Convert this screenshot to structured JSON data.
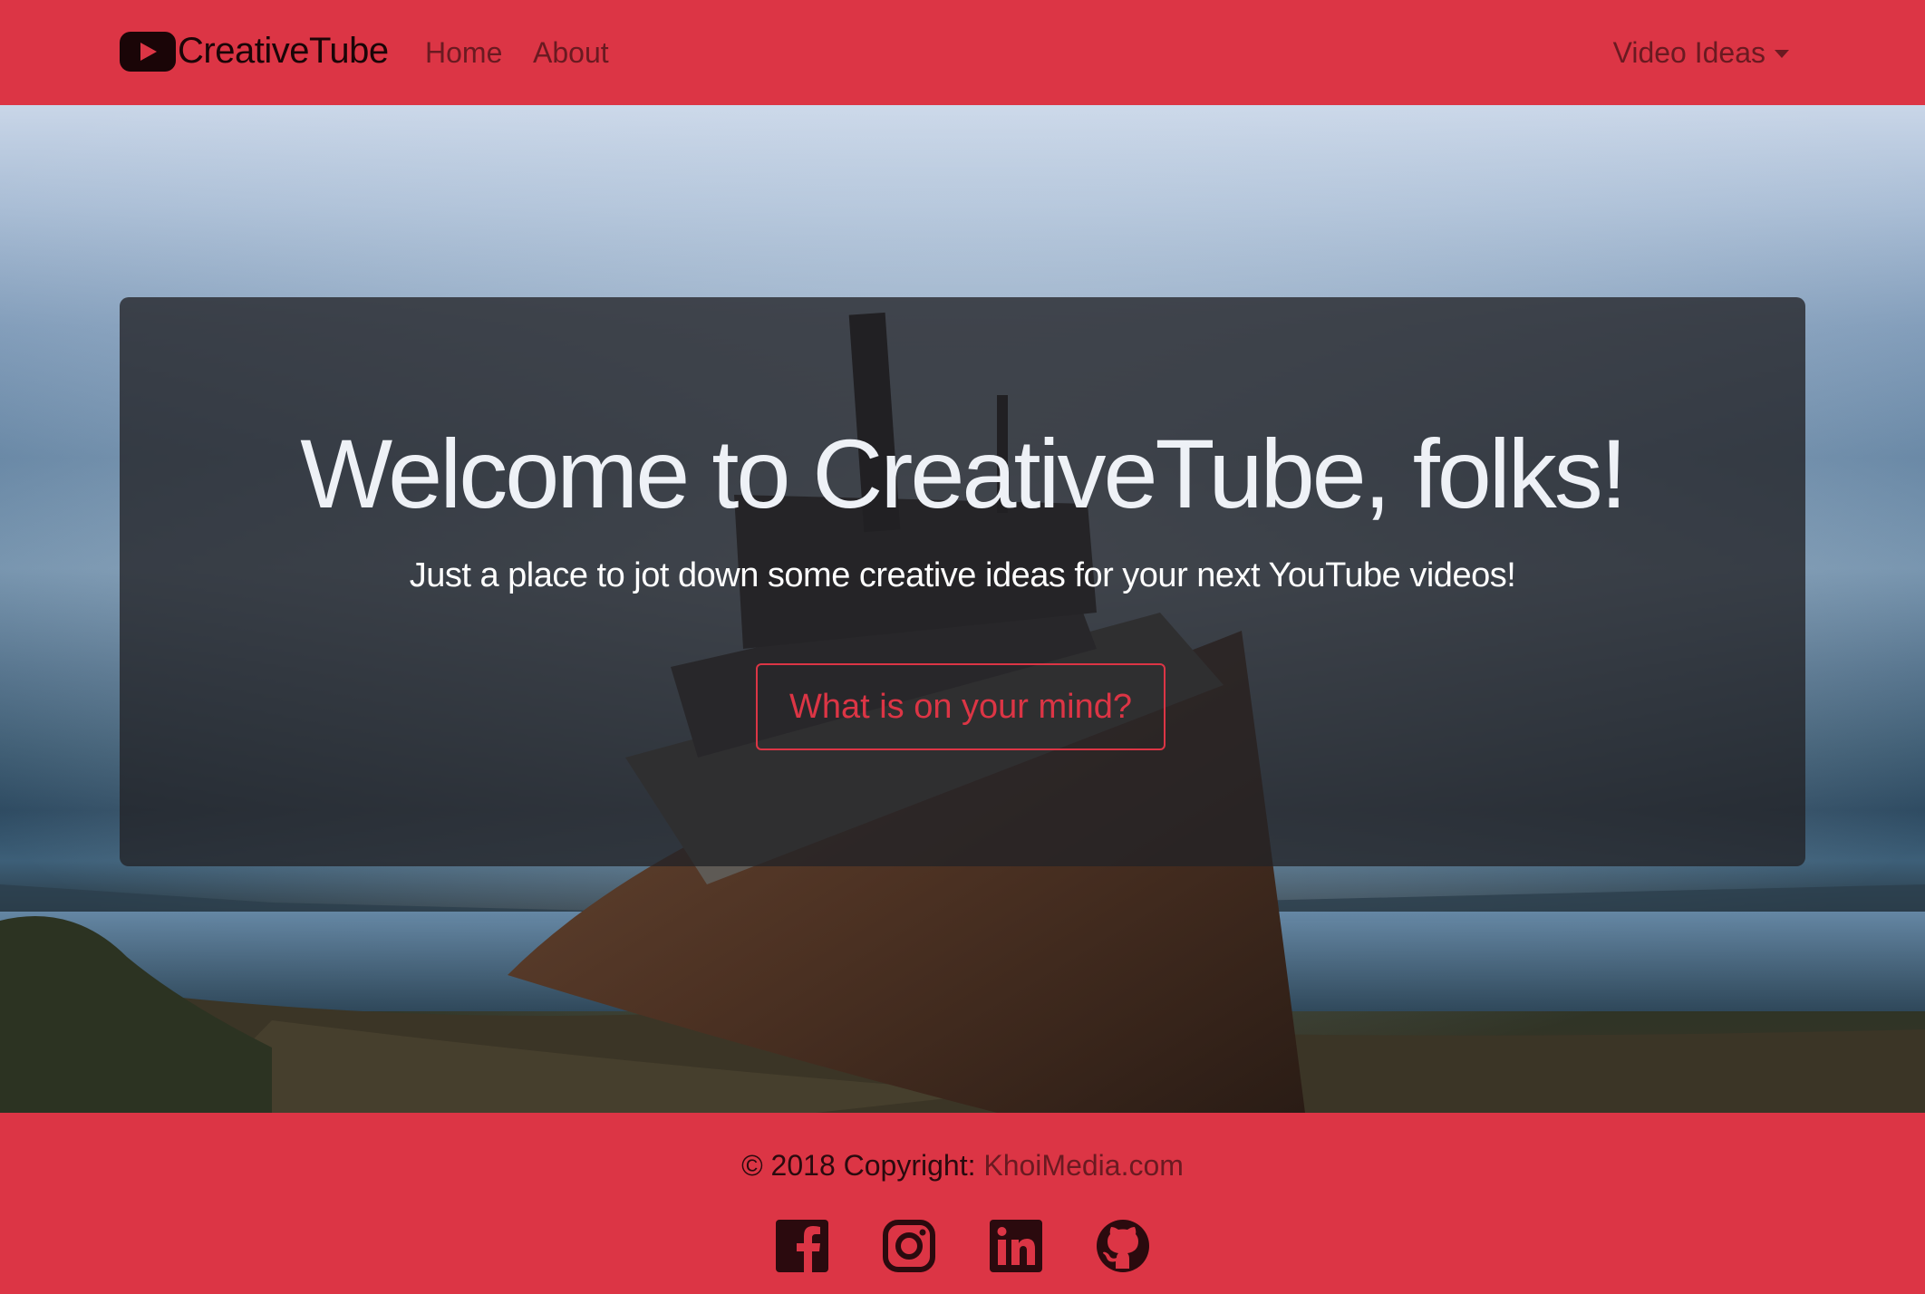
{
  "navbar": {
    "brand": "CreativeTube",
    "links": [
      "Home",
      "About"
    ],
    "dropdown_label": "Video Ideas"
  },
  "hero": {
    "title": "Welcome to CreativeTube, folks!",
    "subtitle": "Just a place to jot down some creative ideas for your next YouTube videos!",
    "button_label": "What is on your mind?"
  },
  "footer": {
    "copyright_prefix": "© 2018 Copyright: ",
    "copyright_link": "KhoiMedia.com",
    "social_icons": [
      "facebook-icon",
      "instagram-icon",
      "linkedin-icon",
      "github-icon"
    ]
  },
  "colors": {
    "brand_red": "#dc3545",
    "jumbotron_overlay": "rgba(34,34,38,0.78)",
    "dark_text": "#1a0507"
  }
}
